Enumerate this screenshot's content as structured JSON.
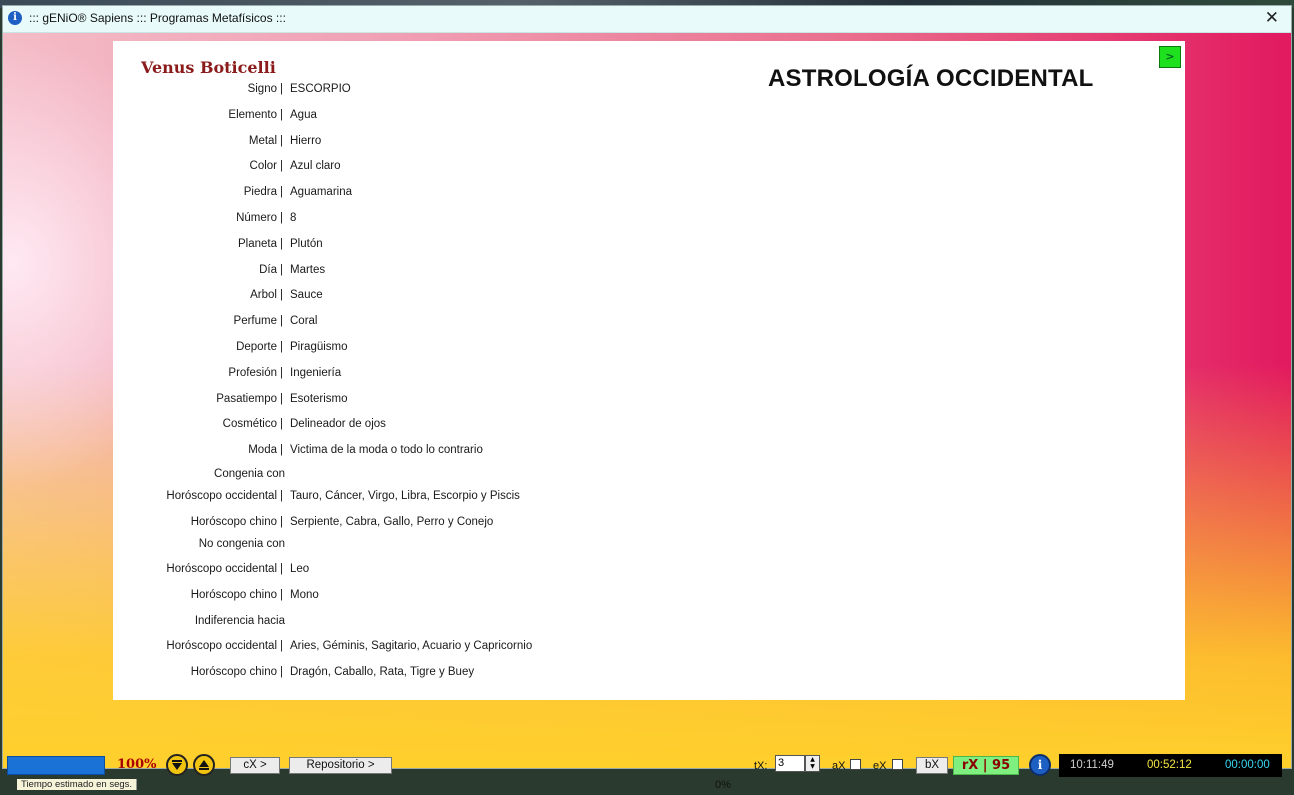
{
  "window": {
    "title": "::: gENiO® Sapiens ::: Programas Metafísicos :::",
    "close_glyph": "✕"
  },
  "panel": {
    "person_name": "Venus Boticelli",
    "section_title": "ASTROLOGÍA OCCIDENTAL",
    "next_label": ">"
  },
  "attributes": [
    {
      "label": "Signo",
      "value": "ESCORPIO"
    },
    {
      "label": "Elemento",
      "value": "Agua"
    },
    {
      "label": "Metal",
      "value": "Hierro"
    },
    {
      "label": "Color",
      "value": "Azul claro"
    },
    {
      "label": "Piedra",
      "value": "Aguamarina"
    },
    {
      "label": "Número",
      "value": "8"
    },
    {
      "label": "Planeta",
      "value": "Plutón"
    },
    {
      "label": "Día",
      "value": "Martes"
    },
    {
      "label": "Arbol",
      "value": "Sauce"
    },
    {
      "label": "Perfume",
      "value": "Coral"
    },
    {
      "label": "Deporte",
      "value": "Piragüismo"
    },
    {
      "label": "Profesión",
      "value": "Ingeniería"
    },
    {
      "label": "Pasatiempo",
      "value": "Esoterismo"
    },
    {
      "label": "Cosmético",
      "value": "Delineador de ojos"
    },
    {
      "label": "Moda",
      "value": "Victima de la moda o todo lo contrario"
    }
  ],
  "compatibility": {
    "congenia_header": "Congenia con",
    "congenia_occidental_label": "Horóscopo occidental",
    "congenia_occidental_value": "Tauro, Cáncer, Virgo, Libra, Escorpio y Piscis",
    "congenia_chino_label": "Horóscopo chino",
    "congenia_chino_value": "Serpiente, Cabra, Gallo, Perro y Conejo",
    "no_congenia_header": "No congenia con",
    "no_congenia_occidental_label": "Horóscopo occidental",
    "no_congenia_occidental_value": "Leo",
    "no_congenia_chino_label": "Horóscopo chino",
    "no_congenia_chino_value": "Mono",
    "indiferencia_header": "Indiferencia hacia",
    "indiferencia_occidental_label": "Horóscopo occidental",
    "indiferencia_occidental_value": "Aries, Géminis, Sagitario, Acuario y Capricornio",
    "indiferencia_chino_label": "Horóscopo chino",
    "indiferencia_chino_value": "Dragón, Caballo, Rata, Tigre y Buey"
  },
  "separator": "|",
  "bottombar": {
    "percent": "100%",
    "progress_fraction": 1.0,
    "cx_label": "cX >",
    "repositorio_label": "Repositorio >",
    "tx_label": "tX:",
    "tx_value": "3",
    "ax_label": "aX",
    "ex_label": "eX",
    "bx_label": "bX",
    "rx_label": "rX | 95",
    "info_glyph": "i",
    "clock_1": "10:11:49",
    "clock_2": "00:52:12",
    "clock_3": "00:00:00",
    "status_text": "Tiempo estimado en segs.",
    "status_pct": "0%"
  },
  "colors": {
    "name_color": "#8b1a1a",
    "next_button": "#1ee01e",
    "rx_background": "#7ff07f",
    "clock_1": "#cfcfcf",
    "clock_2": "#f5e642",
    "clock_3": "#35d6f0"
  }
}
